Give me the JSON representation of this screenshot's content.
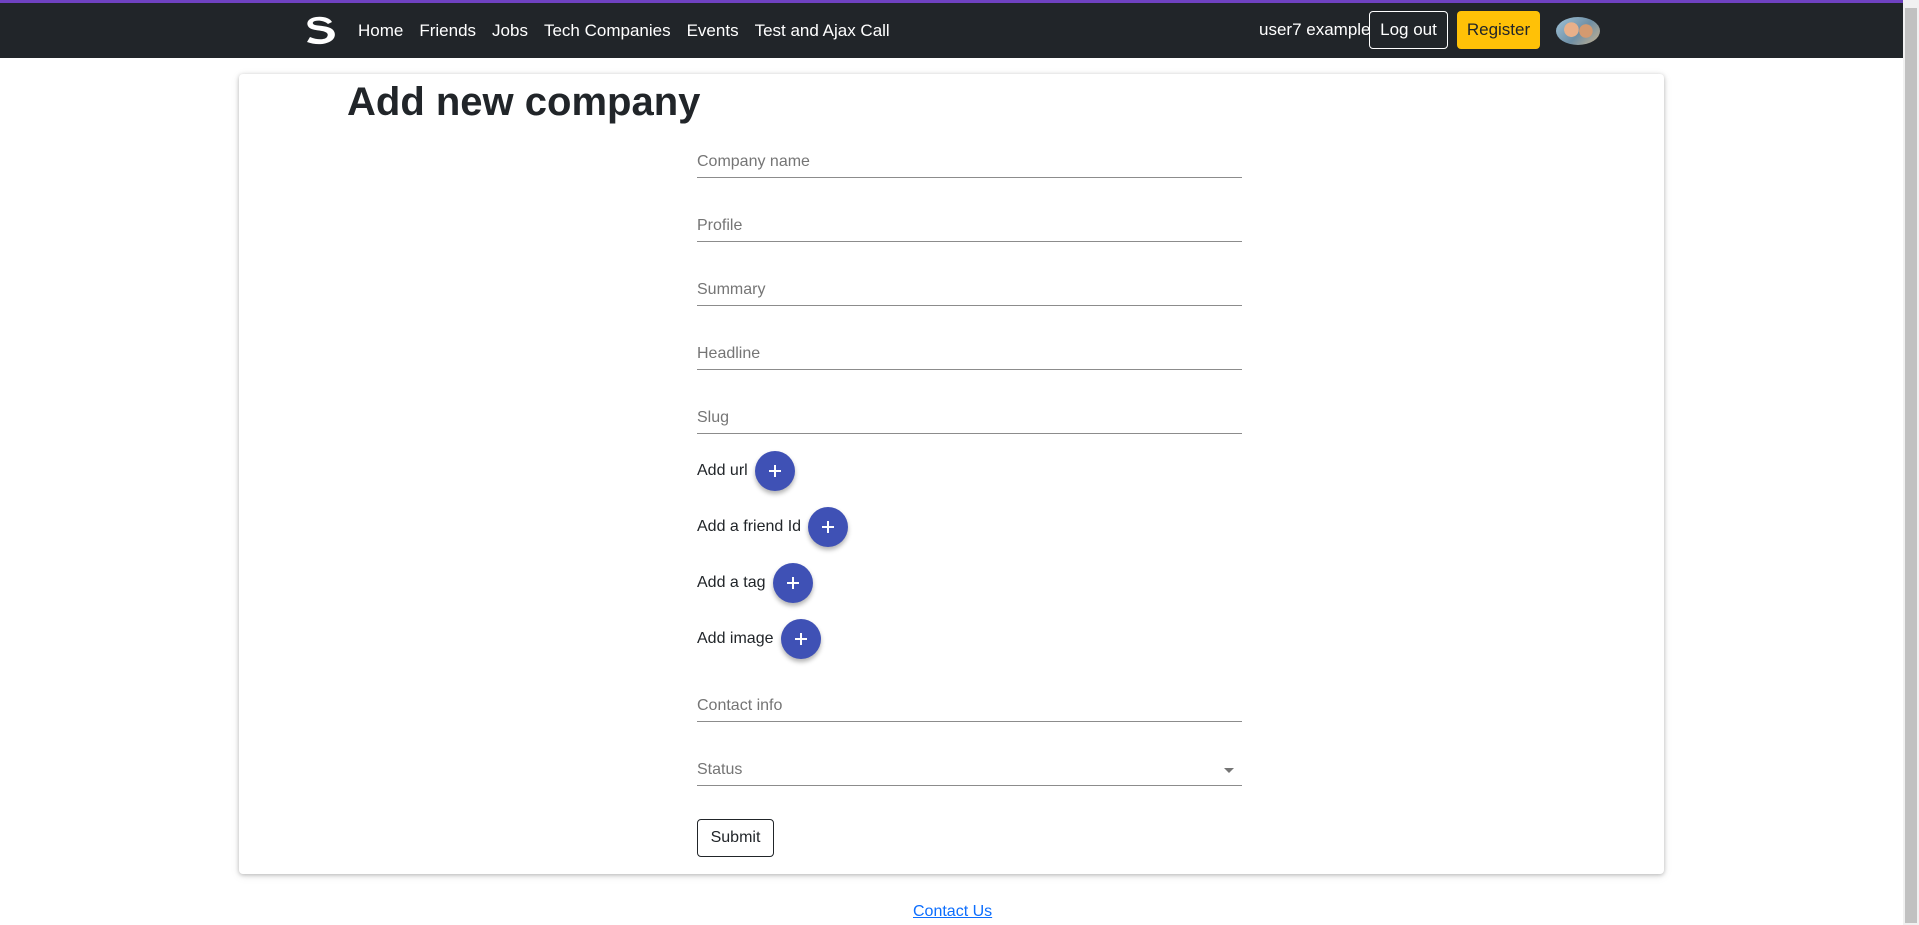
{
  "colors": {
    "navbar_bg": "#212529",
    "accent_top": "#6f42c1",
    "register_bg": "#ffc107",
    "fab_bg": "#3f51b5",
    "link": "#0d6efd"
  },
  "navbar": {
    "brand_icon": "s-logo-icon",
    "links": [
      "Home",
      "Friends",
      "Jobs",
      "Tech Companies",
      "Events",
      "Test and Ajax Call"
    ],
    "user_name": "user7 example",
    "logout_label": "Log out",
    "register_label": "Register",
    "avatar_icon": "user-avatar"
  },
  "page": {
    "title": "Add new company"
  },
  "form": {
    "company_name_placeholder": "Company name",
    "profile_placeholder": "Profile",
    "summary_placeholder": "Summary",
    "headline_placeholder": "Headline",
    "slug_placeholder": "Slug",
    "add_url_label": "Add url",
    "add_friend_label": "Add a friend Id",
    "add_tag_label": "Add a tag",
    "add_image_label": "Add image",
    "add_icon": "plus-icon",
    "contact_info_placeholder": "Contact info",
    "status_label": "Status",
    "status_icon": "caret-down-icon",
    "submit_label": "Submit"
  },
  "footer": {
    "contact_label": "Contact Us"
  }
}
